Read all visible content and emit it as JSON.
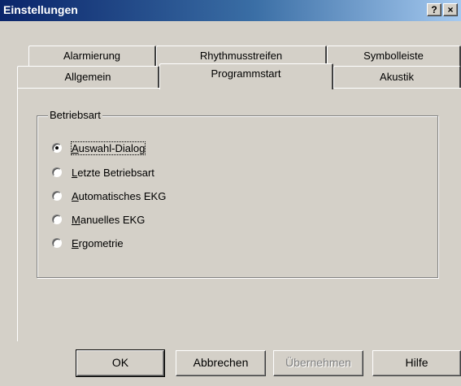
{
  "window": {
    "title": "Einstellungen",
    "help_button": "?",
    "close_button": "×"
  },
  "tabs": {
    "back_row": [
      "Alarmierung",
      "Rhythmusstreifen",
      "Symbolleiste"
    ],
    "front_row": [
      "Allgemein",
      "Programmstart",
      "Akustik"
    ],
    "selected": "Programmstart"
  },
  "group": {
    "title": "Betriebsart",
    "options": [
      {
        "label": "Auswahl-Dialog",
        "checked": true
      },
      {
        "label": "Letzte Betriebsart",
        "checked": false
      },
      {
        "label": "Automatisches EKG",
        "checked": false
      },
      {
        "label": "Manuelles EKG",
        "checked": false
      },
      {
        "label": "Ergometrie",
        "checked": false
      }
    ]
  },
  "buttons": {
    "ok": "OK",
    "cancel": "Abbrechen",
    "apply": "Übernehmen",
    "help": "Hilfe"
  }
}
